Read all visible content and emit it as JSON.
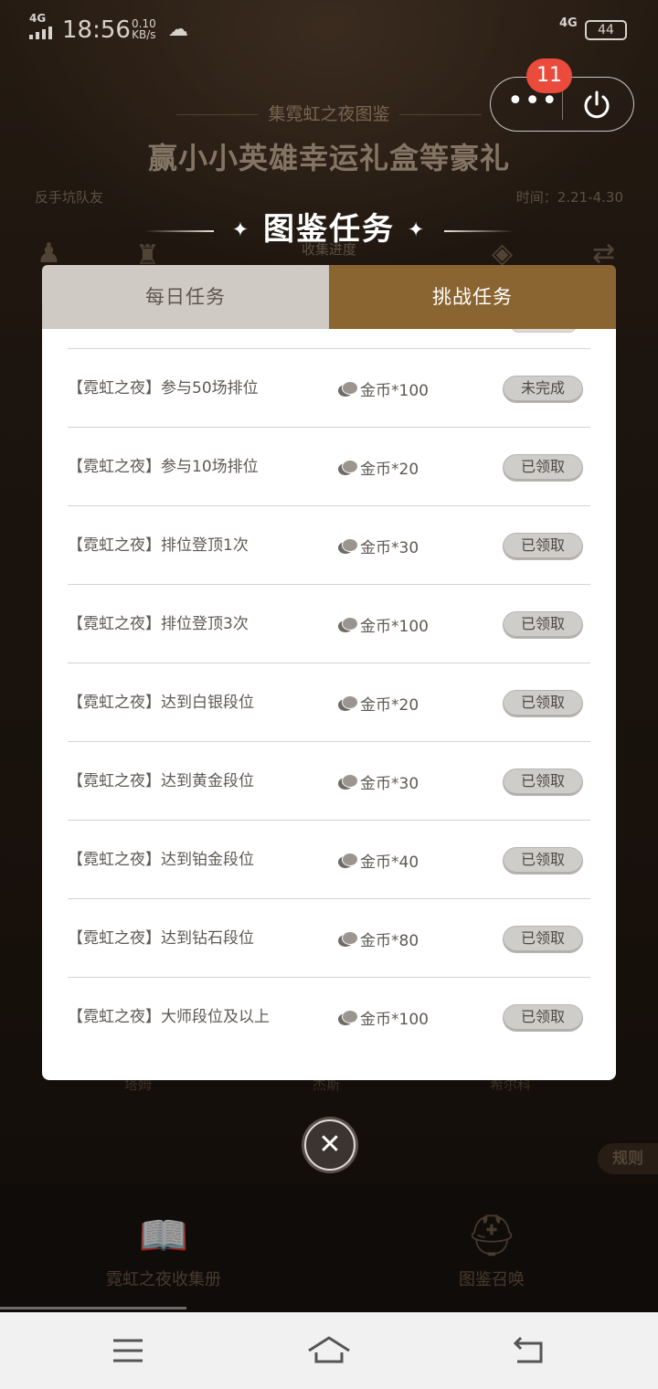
{
  "status_bar": {
    "network_left": "4G",
    "time": "18:56",
    "speed_value": "0.10",
    "speed_unit": "KB/s",
    "network_right": "4G",
    "battery": "44"
  },
  "capsule": {
    "badge_count": "11"
  },
  "background": {
    "collect_title": "集霓虹之夜图鉴",
    "headline": "赢小小英雄幸运礼盒等豪礼",
    "left_small": "反手坑队友",
    "right_small": "时间：2.21-4.30",
    "progress_label": "收集进度",
    "card_labels": [
      "塔姆",
      "杰斯",
      "希尔科"
    ],
    "rules_label": "规则",
    "bottom_nav": [
      {
        "label": "霓虹之夜收集册",
        "icon": "book-icon"
      },
      {
        "label": "图鉴召唤",
        "icon": "helmet-icon"
      }
    ]
  },
  "modal": {
    "title": "图鉴任务",
    "tabs": [
      {
        "label": "每日任务",
        "active": false
      },
      {
        "label": "挑战任务",
        "active": true
      }
    ],
    "tasks": [
      {
        "name": "【霓虹之夜】参与50场排位",
        "reward": "金币*100",
        "status": "未完成"
      },
      {
        "name": "【霓虹之夜】参与10场排位",
        "reward": "金币*20",
        "status": "已领取"
      },
      {
        "name": "【霓虹之夜】排位登顶1次",
        "reward": "金币*30",
        "status": "已领取"
      },
      {
        "name": "【霓虹之夜】排位登顶3次",
        "reward": "金币*100",
        "status": "已领取"
      },
      {
        "name": "【霓虹之夜】达到白银段位",
        "reward": "金币*20",
        "status": "已领取"
      },
      {
        "name": "【霓虹之夜】达到黄金段位",
        "reward": "金币*30",
        "status": "已领取"
      },
      {
        "name": "【霓虹之夜】达到铂金段位",
        "reward": "金币*40",
        "status": "已领取"
      },
      {
        "name": "【霓虹之夜】达到钻石段位",
        "reward": "金币*80",
        "status": "已领取"
      },
      {
        "name": "【霓虹之夜】大师段位及以上",
        "reward": "金币*100",
        "status": "已领取"
      }
    ]
  },
  "colors": {
    "tab_active": "#8b6531",
    "tab_inactive": "#cfcbc4",
    "badge": "#ea4b3c"
  }
}
